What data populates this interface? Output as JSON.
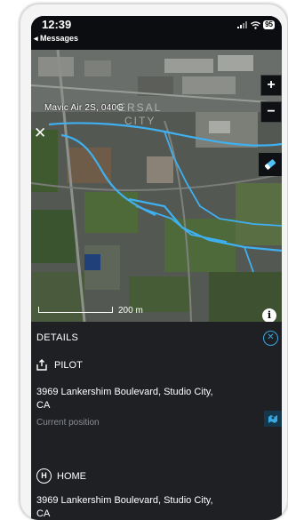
{
  "status": {
    "time": "12:39",
    "back_app": "◂ Messages",
    "battery": "95"
  },
  "map": {
    "drone_label": "Mavic Air 2S, 040G",
    "area_label_1": "ERSAL",
    "area_label_2": "CITY",
    "zoom_in": "+",
    "zoom_out": "−",
    "close": "✕",
    "scale": "200 m",
    "info": "i"
  },
  "details": {
    "title": "DETAILS",
    "pilot": {
      "label": "PILOT",
      "address": "3969 Lankershim Boulevard, Studio City, CA",
      "note": "Current position"
    },
    "home": {
      "label": "HOME",
      "icon_letter": "H",
      "address": "3969 Lankershim Boulevard, Studio City, CA"
    }
  },
  "colors": {
    "accent": "#38a8e0",
    "flight_path": "#3fb0f0",
    "panel": "#1e2024"
  }
}
